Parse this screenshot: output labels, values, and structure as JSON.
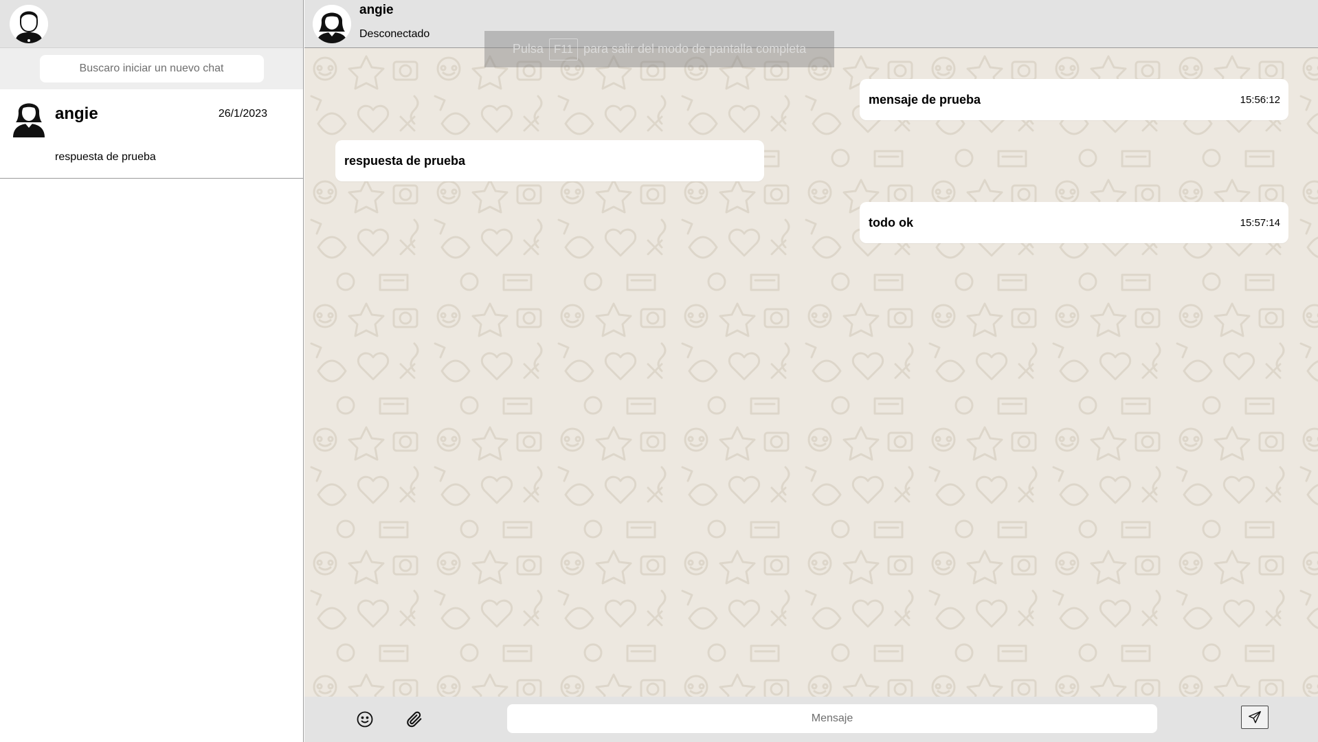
{
  "sidebar": {
    "search_placeholder": "Buscaro iniciar un nuevo chat",
    "chats": [
      {
        "name": "angie",
        "date": "26/1/2023",
        "last_message": "respuesta de prueba"
      }
    ]
  },
  "conversation": {
    "contact_name": "angie",
    "status": "Desconectado",
    "messages": [
      {
        "text": "mensaje de prueba",
        "time": "15:56:12",
        "direction": "outgoing"
      },
      {
        "text": "respuesta de prueba",
        "time": "",
        "direction": "incoming"
      },
      {
        "text": "todo ok",
        "time": "15:57:14",
        "direction": "outgoing"
      }
    ]
  },
  "composer": {
    "placeholder": "Mensaje",
    "emoji_icon": "smiley-icon",
    "attach_icon": "paperclip-icon",
    "send_icon": "paper-plane-icon"
  },
  "fullscreen_notice": {
    "before": "Pulsa",
    "key": "F11",
    "after": "para salir del modo de pantalla completa"
  },
  "colors": {
    "header_bg": "#e3e3e3",
    "chat_bg": "#ede8e0",
    "bubble_bg": "#ffffff"
  }
}
